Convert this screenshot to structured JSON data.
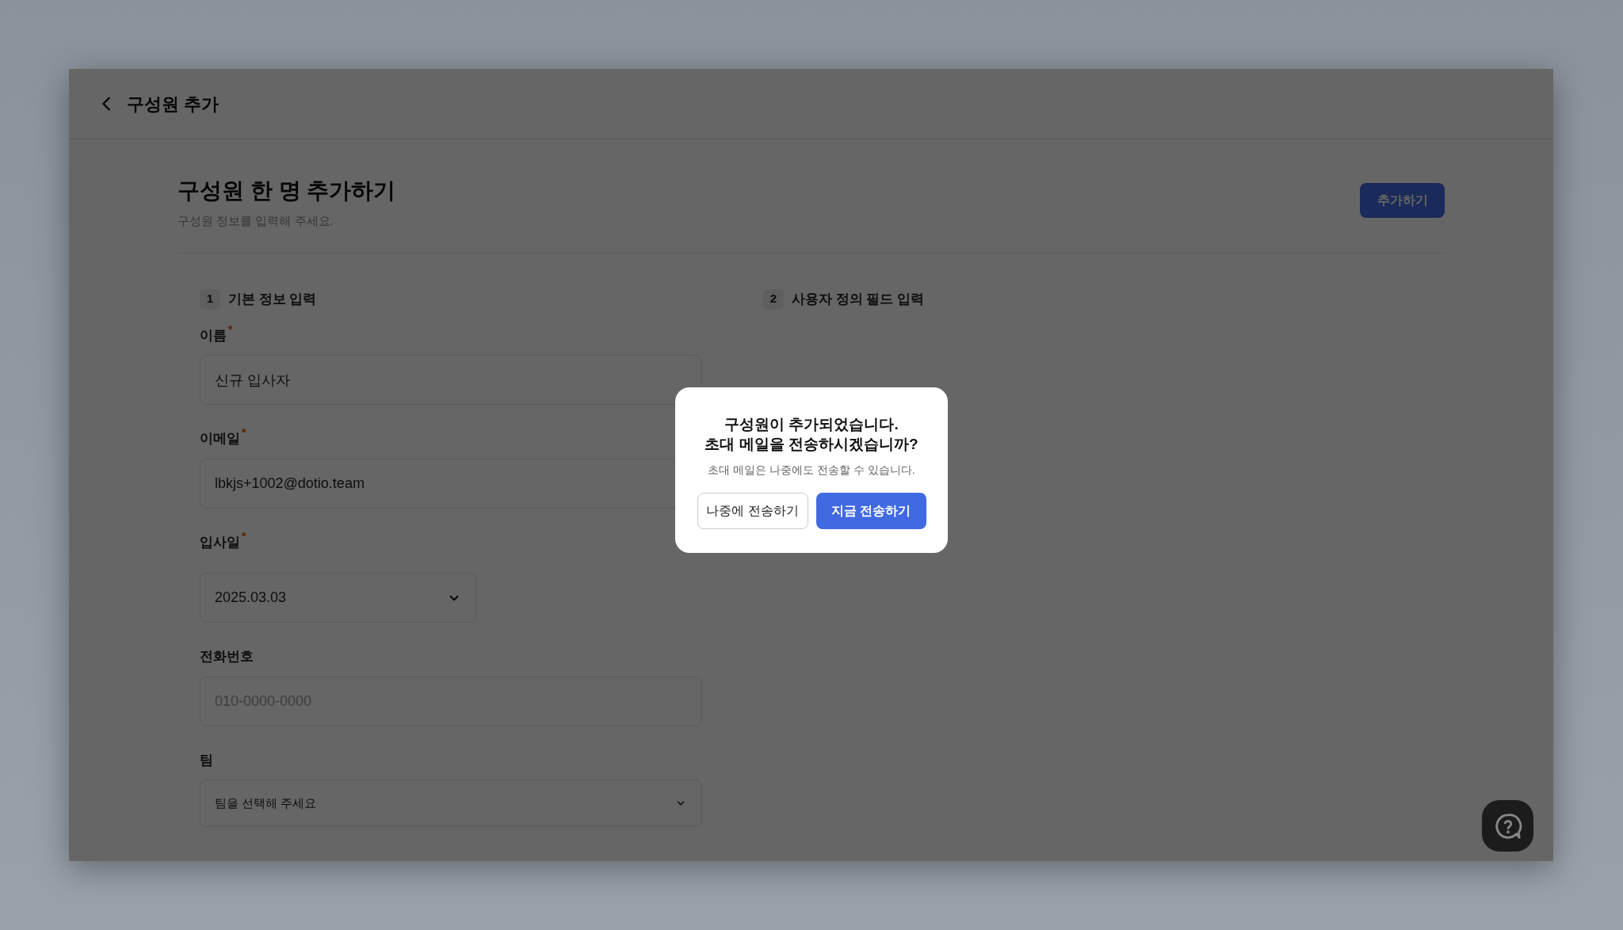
{
  "header": {
    "title": "구성원 추가"
  },
  "page": {
    "title": "구성원 한 명 추가하기",
    "subtitle": "구성원 정보를 입력해 주세요.",
    "submit_button": "추가하기"
  },
  "steps": [
    {
      "number": "1",
      "label": "기본 정보 입력"
    },
    {
      "number": "2",
      "label": "사용자 정의 필드 입력"
    }
  ],
  "fields": [
    {
      "kind": "text",
      "label": "이름",
      "required": true,
      "value": "신규 입사자"
    },
    {
      "kind": "text",
      "label": "이메일",
      "required": true,
      "value": "lbkjs+1002@dotio.team"
    },
    {
      "kind": "date",
      "label": "입사일",
      "required": true,
      "value": "2025.03.03"
    },
    {
      "kind": "text",
      "label": "전화번호",
      "required": false,
      "placeholder": "010-0000-0000"
    },
    {
      "kind": "select",
      "label": "팀",
      "required": false,
      "value": "팀을 선택해 주세요"
    }
  ],
  "dialog": {
    "title_lines": [
      "구성원이 추가되었습니다.",
      "초대 메일을 전송하시겠습니까?"
    ],
    "message": "초대 메일은 나중에도 전송할 수 있습니다.",
    "buttons": [
      {
        "kind": "secondary",
        "label": "나중에 전송하기"
      },
      {
        "kind": "primary",
        "label": "지금 전송하기"
      }
    ]
  }
}
